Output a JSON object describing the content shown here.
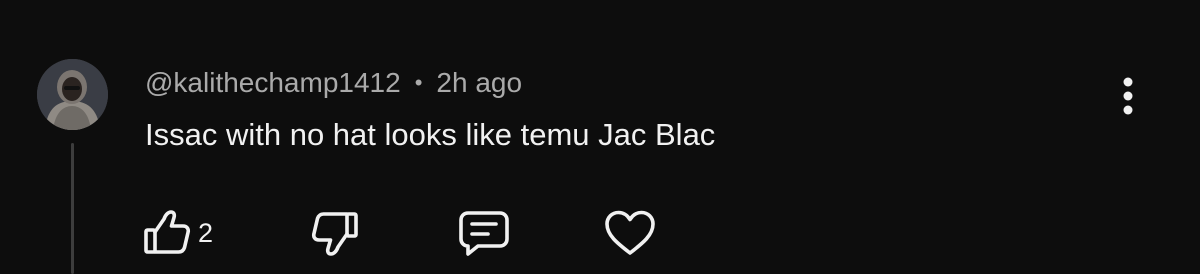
{
  "comment": {
    "author": "@kalithechamp1412",
    "separator": "•",
    "time": "2h ago",
    "text": "Issac with no hat looks like temu Jac Blac"
  },
  "actions": {
    "like_count": "2"
  },
  "icons": {
    "menu": "more-vert-icon",
    "like": "thumbs-up-icon",
    "dislike": "thumbs-down-icon",
    "reply": "reply-comment-icon",
    "heart": "heart-icon"
  },
  "colors": {
    "background": "#0d0d0d",
    "primary_text": "#f1f1f1",
    "secondary_text": "#aaaaaa"
  }
}
